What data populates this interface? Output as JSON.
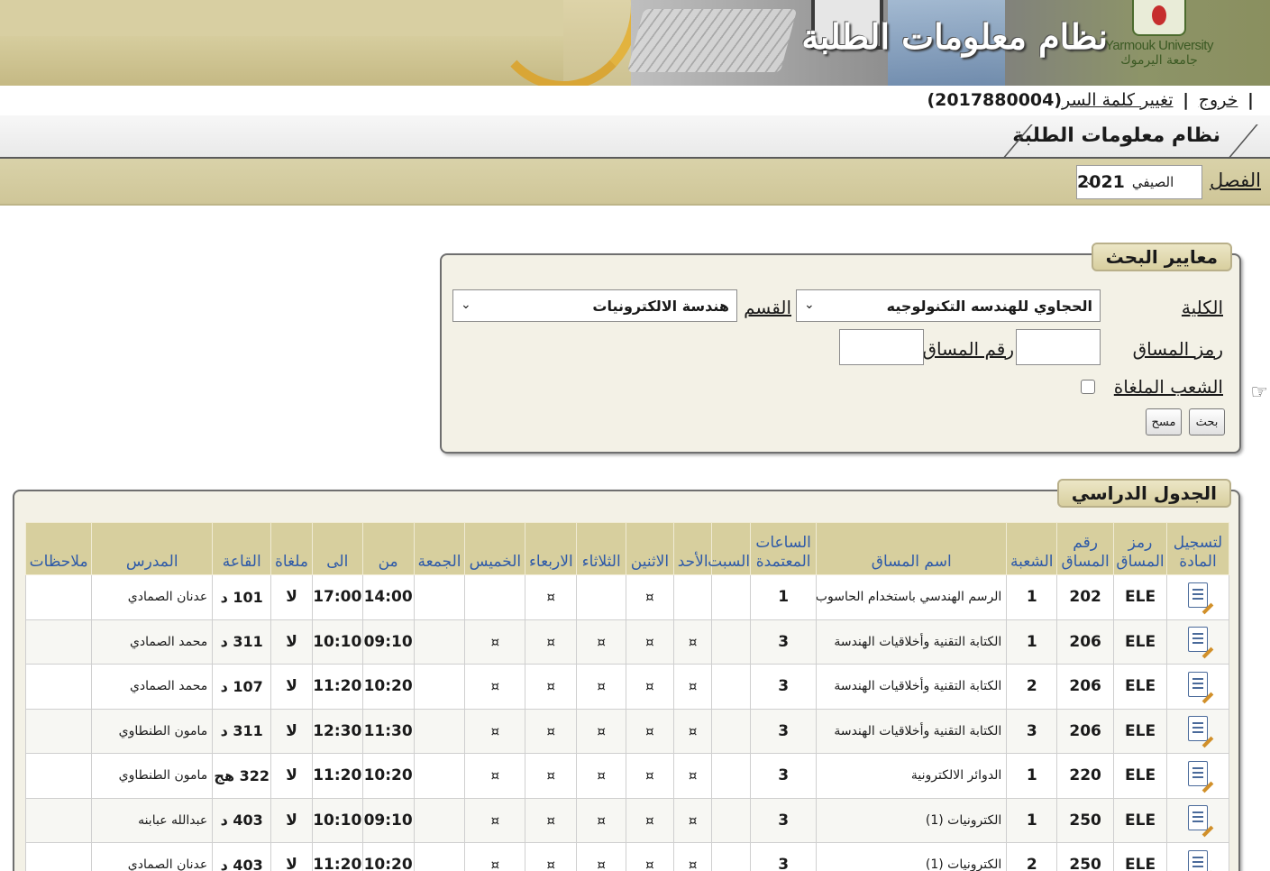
{
  "banner": {
    "title": "نظام معلومات الطلبة",
    "logo_en": "Yarmouk University",
    "logo_ar": "جامعة اليرموك"
  },
  "userbar": {
    "logout": "خروج",
    "change_password": "تغيير كلمة السر",
    "student_id": "(2017880004)"
  },
  "module_tab": "نظام معلومات الطلبة",
  "semester": {
    "label": "الفصل",
    "term": "الصيفي",
    "year": "2021"
  },
  "search": {
    "legend": "معايير البحث",
    "faculty_label": "الكلية",
    "faculty_value": "الحجاوي للهندسه التكنولوجيه",
    "department_label": "القسم",
    "department_value": "هندسة الالكترونيات",
    "course_code_label": "رمز المساق",
    "course_number_label": "رقم المساق",
    "cancelled_sections_label": "الشعب الملغاة",
    "search_button": "بحث",
    "clear_button": "مسح"
  },
  "schedule": {
    "legend": "الجدول الدراسي",
    "columns": [
      "لتسجيل المادة",
      "رمز المساق",
      "رقم المساق",
      "الشعبة",
      "اسم المساق",
      "الساعات المعتمدة",
      "السبت",
      "الأحد",
      "الاثنين",
      "الثلاثاء",
      "الاربعاء",
      "الخميس",
      "الجمعة",
      "من",
      "الى",
      "ملغاة",
      "القاعة",
      "المدرس",
      "ملاحظات"
    ],
    "rows": [
      {
        "code": "ELE",
        "number": "202",
        "section": "1",
        "name": "الرسم الهندسي باستخدام الحاسوب",
        "hours": "1",
        "sat": "",
        "sun": "",
        "mon": "¤",
        "tue": "",
        "wed": "¤",
        "thu": "",
        "fri": "",
        "from": "14:00",
        "to": "17:00",
        "cancelled": "لا",
        "room": "101 د",
        "instructor": "عدنان الصمادي",
        "notes": ""
      },
      {
        "code": "ELE",
        "number": "206",
        "section": "1",
        "name": "الكتابة التقنية وأخلاقيات الهندسة",
        "hours": "3",
        "sat": "",
        "sun": "¤",
        "mon": "¤",
        "tue": "¤",
        "wed": "¤",
        "thu": "¤",
        "fri": "",
        "from": "09:10",
        "to": "10:10",
        "cancelled": "لا",
        "room": "311 د",
        "instructor": "محمد الصمادي",
        "notes": ""
      },
      {
        "code": "ELE",
        "number": "206",
        "section": "2",
        "name": "الكتابة التقنية وأخلاقيات الهندسة",
        "hours": "3",
        "sat": "",
        "sun": "¤",
        "mon": "¤",
        "tue": "¤",
        "wed": "¤",
        "thu": "¤",
        "fri": "",
        "from": "10:20",
        "to": "11:20",
        "cancelled": "لا",
        "room": "107 د",
        "instructor": "محمد الصمادي",
        "notes": ""
      },
      {
        "code": "ELE",
        "number": "206",
        "section": "3",
        "name": "الكتابة التقنية وأخلاقيات الهندسة",
        "hours": "3",
        "sat": "",
        "sun": "¤",
        "mon": "¤",
        "tue": "¤",
        "wed": "¤",
        "thu": "¤",
        "fri": "",
        "from": "11:30",
        "to": "12:30",
        "cancelled": "لا",
        "room": "311 د",
        "instructor": "مامون الطنطاوي",
        "notes": ""
      },
      {
        "code": "ELE",
        "number": "220",
        "section": "1",
        "name": "الدوائر الالكترونية",
        "hours": "3",
        "sat": "",
        "sun": "¤",
        "mon": "¤",
        "tue": "¤",
        "wed": "¤",
        "thu": "¤",
        "fri": "",
        "from": "10:20",
        "to": "11:20",
        "cancelled": "لا",
        "room": "322 هج",
        "instructor": "مامون الطنطاوي",
        "notes": ""
      },
      {
        "code": "ELE",
        "number": "250",
        "section": "1",
        "name": "الكترونيات (1)",
        "hours": "3",
        "sat": "",
        "sun": "¤",
        "mon": "¤",
        "tue": "¤",
        "wed": "¤",
        "thu": "¤",
        "fri": "",
        "from": "09:10",
        "to": "10:10",
        "cancelled": "لا",
        "room": "403 د",
        "instructor": "عبدالله عبابنه",
        "notes": ""
      },
      {
        "code": "ELE",
        "number": "250",
        "section": "2",
        "name": "الكترونيات (1)",
        "hours": "3",
        "sat": "",
        "sun": "¤",
        "mon": "¤",
        "tue": "¤",
        "wed": "¤",
        "thu": "¤",
        "fri": "",
        "from": "10:20",
        "to": "11:20",
        "cancelled": "لا",
        "room": "403 د",
        "instructor": "عدنان الصمادي",
        "notes": ""
      }
    ]
  }
}
